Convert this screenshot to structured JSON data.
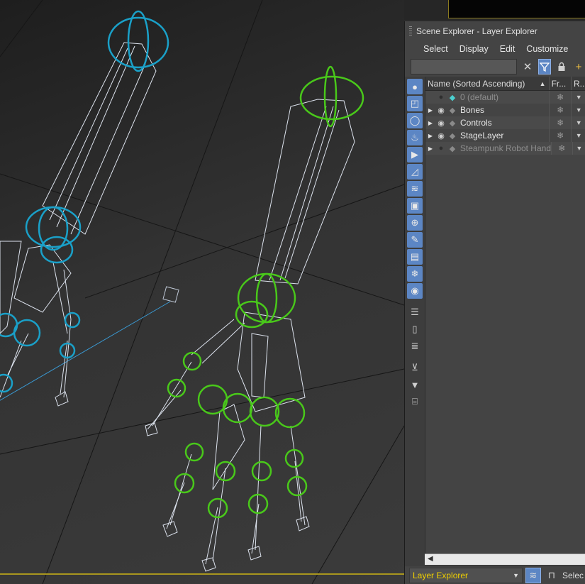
{
  "panel": {
    "title": "Scene Explorer - Layer Explorer",
    "menu": [
      "Select",
      "Display",
      "Edit",
      "Customize"
    ],
    "search": {
      "value": "",
      "placeholder": ""
    },
    "toolbar": {
      "clear_icon": "close-icon",
      "filter_icon": "filter-icon",
      "lock_icon": "lock-icon",
      "add_icon": "add-layer-icon"
    },
    "columns": {
      "name": "Name (Sorted Ascending)",
      "sort_arrow": "▲",
      "frozen": "Fr...",
      "render": "R..."
    },
    "layers": [
      {
        "name": "0 (default)",
        "expandable": false,
        "visible": false,
        "current": true,
        "dim": true
      },
      {
        "name": "Bones",
        "expandable": true,
        "visible": true,
        "current": false,
        "dim": false
      },
      {
        "name": "Controls",
        "expandable": true,
        "visible": true,
        "current": false,
        "dim": false
      },
      {
        "name": "StageLayer",
        "expandable": true,
        "visible": true,
        "current": false,
        "dim": false
      },
      {
        "name": "Steampunk Robot Hand",
        "expandable": true,
        "visible": false,
        "current": false,
        "dim": true
      }
    ],
    "frozen_glyph": "❄",
    "side_icons": [
      "display-all-icon",
      "geometry-icon",
      "shapes-icon",
      "lights-icon",
      "cameras-icon",
      "helpers-icon",
      "space-warps-icon",
      "groups-icon",
      "xrefs-icon",
      "bones-icon",
      "containers-icon",
      "frozen-icon",
      "hidden-icon",
      "list-icon",
      "page-icon",
      "notes-icon",
      "filter-clear-icon",
      "filter-icon",
      "layer-frame-icon"
    ],
    "bottom": {
      "mode": "Layer Explorer",
      "select_text": "Selec"
    }
  },
  "colors": {
    "accent": "#5c86c4",
    "blue_rig": "#1aa0c8",
    "green_rig": "#49c81a",
    "mode_text": "#f0d000"
  }
}
